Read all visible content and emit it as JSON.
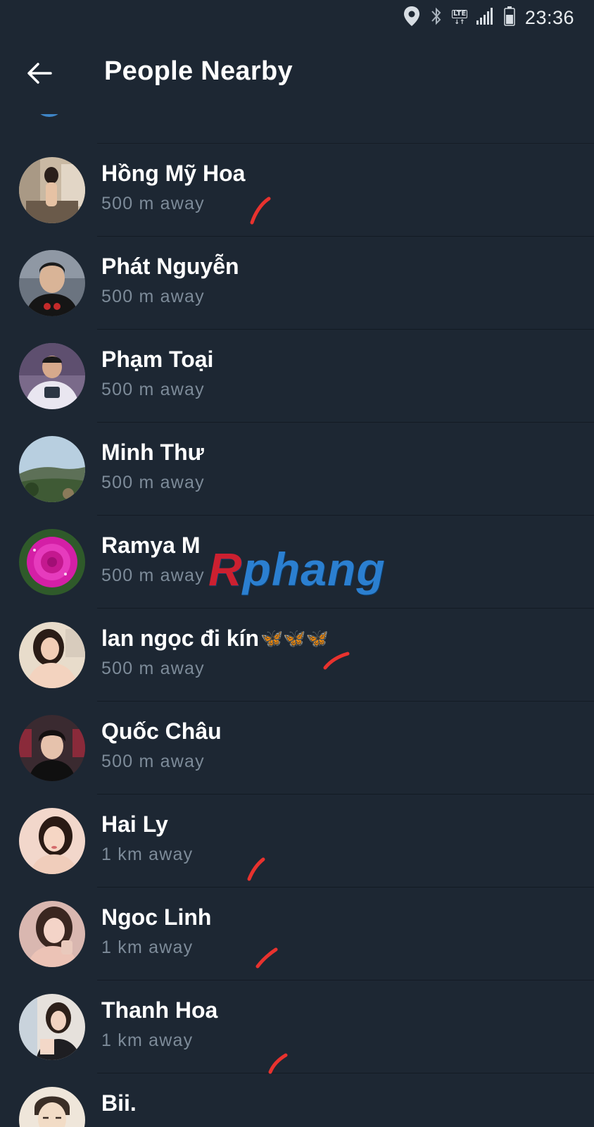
{
  "status_bar": {
    "time": "23:36",
    "icons": [
      "location-icon",
      "bluetooth-icon",
      "lte-icon",
      "signal-icon",
      "battery-icon"
    ],
    "lte_label": "LTE",
    "lte_arrows": "↓↑"
  },
  "header": {
    "title": "People Nearby",
    "back_icon": "arrow-left-icon"
  },
  "people": [
    {
      "name": "Hồng Mỹ Hoa",
      "distance": "500 m away"
    },
    {
      "name": "Phát Nguyễn",
      "distance": "500 m away"
    },
    {
      "name": "Phạm Toại",
      "distance": "500 m away"
    },
    {
      "name": "Minh Thư",
      "distance": "500 m away"
    },
    {
      "name": "Ramya M",
      "distance": "500 m away"
    },
    {
      "name": "lan ngọc đi kín",
      "name_suffix": "🦋🦋🦋",
      "distance": "500 m away"
    },
    {
      "name": "Quốc Châu",
      "distance": "500 m away"
    },
    {
      "name": "Hai Ly",
      "distance": "1 km away"
    },
    {
      "name": "Ngoc Linh",
      "distance": "1 km away"
    },
    {
      "name": "Thanh Hoa",
      "distance": "1 km away"
    },
    {
      "name": "Bii.",
      "distance": ""
    }
  ],
  "watermark": {
    "first_letter": "R",
    "rest": "phang"
  },
  "colors": {
    "background": "#1d2733",
    "divider": "#131b24",
    "name_text": "#ffffff",
    "secondary_text": "#7d8b99",
    "annotation_red": "#e8322e",
    "watermark_blue": "#2b7fd0",
    "watermark_red": "#cc2030"
  }
}
